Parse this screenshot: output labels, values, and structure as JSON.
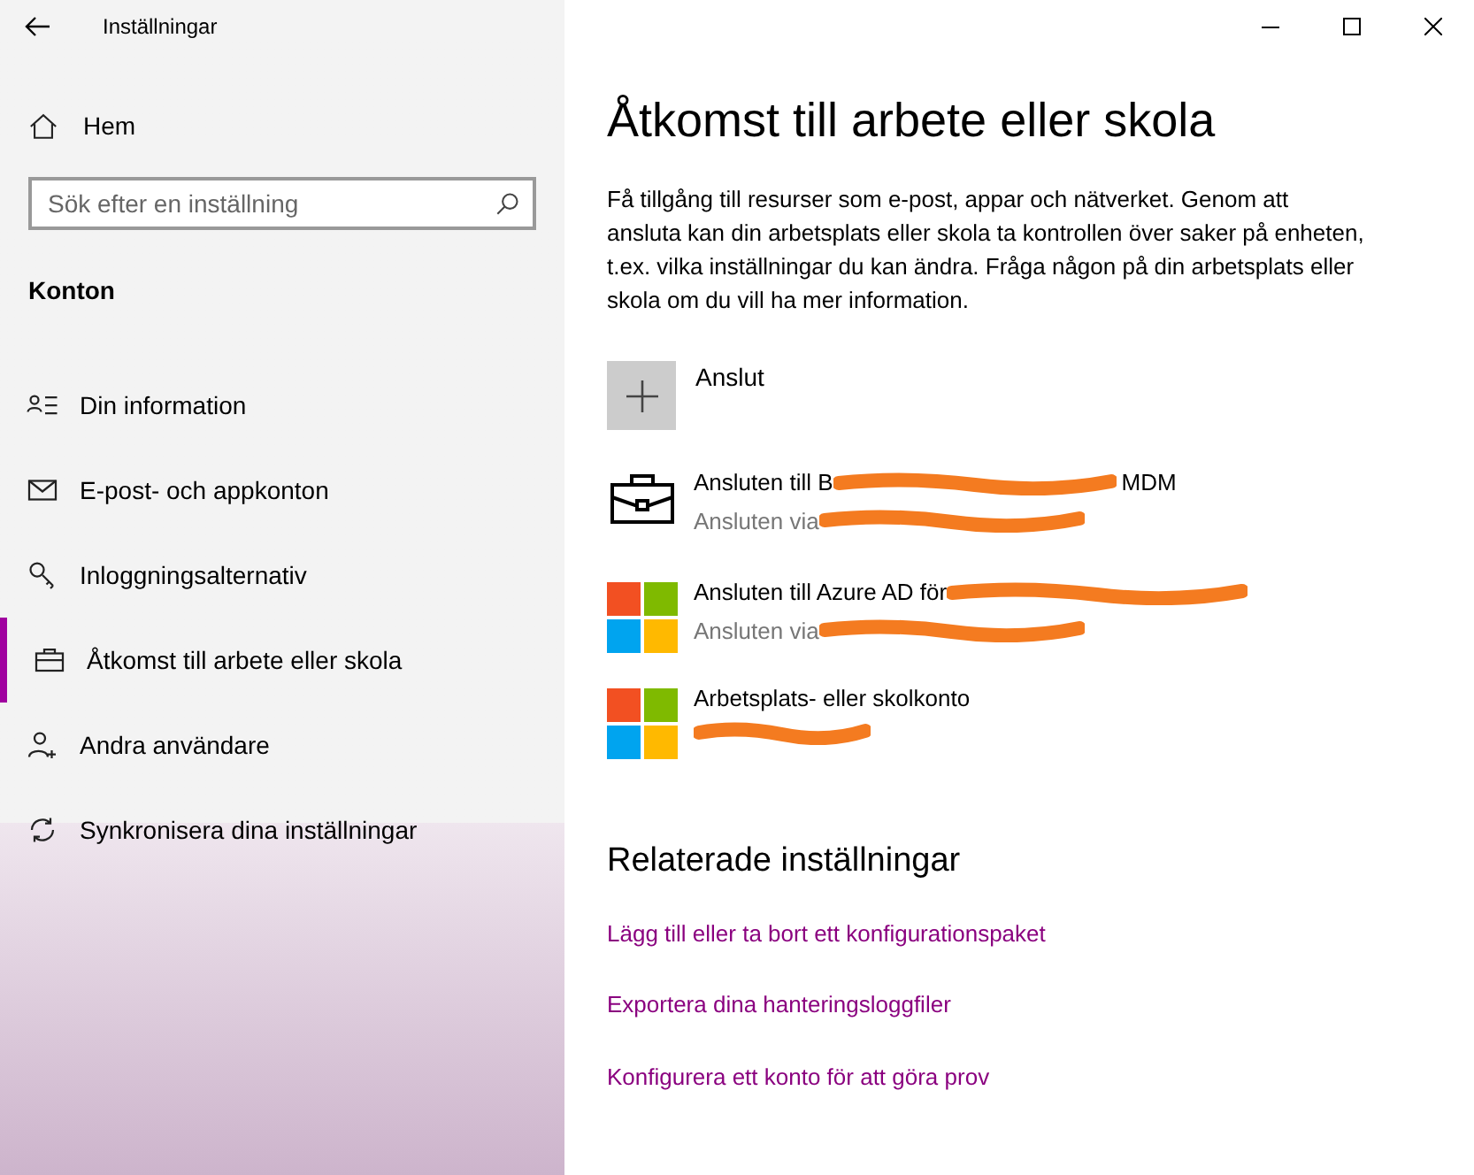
{
  "window": {
    "title": "Inställningar"
  },
  "sidebar": {
    "home": "Hem",
    "search": {
      "placeholder": "Sök efter en inställning"
    },
    "section": "Konton",
    "items": [
      {
        "label": "Din information",
        "selected": false
      },
      {
        "label": "E-post- och appkonton",
        "selected": false
      },
      {
        "label": "Inloggningsalternativ",
        "selected": false
      },
      {
        "label": "Åtkomst till arbete eller skola",
        "selected": true
      },
      {
        "label": "Andra användare",
        "selected": false
      },
      {
        "label": "Synkronisera dina inställningar",
        "selected": false
      }
    ]
  },
  "main": {
    "title": "Åtkomst till arbete eller skola",
    "description": "Få tillgång till resurser som e-post, appar och nätverket. Genom att ansluta kan din arbetsplats eller skola ta kontrollen över saker på enheten, t.ex. vilka inställningar du kan ändra. Fråga någon på din arbetsplats eller skola om du vill ha mer information.",
    "connect": "Anslut",
    "accounts": [
      {
        "kind": "briefcase",
        "title": "Ansluten till B",
        "title_redacted": true,
        "title_end": "MDM",
        "detail": "Ansluten via",
        "detail_redacted": true
      },
      {
        "kind": "windows",
        "title": "Ansluten till Azure AD för",
        "title_redacted": true,
        "detail": "Ansluten via",
        "detail_redacted": true
      },
      {
        "kind": "windows",
        "title": "Arbetsplats- eller skolkonto",
        "title_redacted": false,
        "detail_redacted": true
      }
    ],
    "related_title": "Relaterade inställningar",
    "links": [
      "Lägg till eller ta bort ett konfigurationspaket",
      "Exportera dina hanteringsloggfiler",
      "Konfigurera ett konto för att göra prov"
    ]
  }
}
